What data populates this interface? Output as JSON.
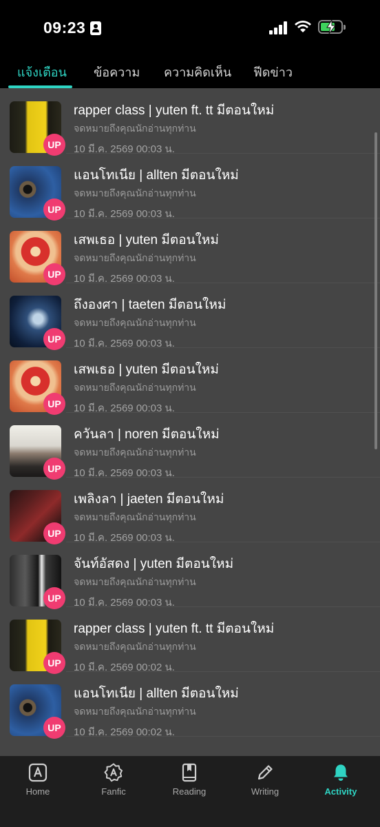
{
  "status_bar": {
    "time": "09:23"
  },
  "tabs": [
    {
      "label": "แจ้งเตือน",
      "active": true
    },
    {
      "label": "ข้อความ",
      "active": false
    },
    {
      "label": "ความคิดเห็น",
      "active": false
    },
    {
      "label": "ฟีดข่าว",
      "active": false
    }
  ],
  "notifications": [
    {
      "title": "rapper class | yuten ft. tt มีตอนใหม่",
      "subtitle": "จดหมายถึงคุณนักอ่านทุกท่าน",
      "date": "10 มี.ค. 2569 00:03 น.",
      "badge": "UP",
      "art": "yellow"
    },
    {
      "title": "แอนโทเนีย | allten มีตอนใหม่",
      "subtitle": "จดหมายถึงคุณนักอ่านทุกท่าน",
      "date": "10 มี.ค. 2569 00:03 น.",
      "badge": "UP",
      "art": "blue"
    },
    {
      "title": "เสพเธอ | yuten มีตอนใหม่",
      "subtitle": "จดหมายถึงคุณนักอ่านทุกท่าน",
      "date": "10 มี.ค. 2569 00:03 น.",
      "badge": "UP",
      "art": "heart"
    },
    {
      "title": "ถึงองศา | taeten มีตอนใหม่",
      "subtitle": "จดหมายถึงคุณนักอ่านทุกท่าน",
      "date": "10 มี.ค. 2569 00:03 น.",
      "badge": "UP",
      "art": "dark"
    },
    {
      "title": "เสพเธอ | yuten มีตอนใหม่",
      "subtitle": "จดหมายถึงคุณนักอ่านทุกท่าน",
      "date": "10 มี.ค. 2569 00:03 น.",
      "badge": "UP",
      "art": "heart"
    },
    {
      "title": "ควันลา | noren มีตอนใหม่",
      "subtitle": "จดหมายถึงคุณนักอ่านทุกท่าน",
      "date": "10 มี.ค. 2569 00:03 น.",
      "badge": "UP",
      "art": "white"
    },
    {
      "title": "เพลิงลา | jaeten มีตอนใหม่",
      "subtitle": "จดหมายถึงคุณนักอ่านทุกท่าน",
      "date": "10 มี.ค. 2569 00:03 น.",
      "badge": "UP",
      "art": "red"
    },
    {
      "title": "จันท์อัสดง | yuten มีตอนใหม่",
      "subtitle": "จดหมายถึงคุณนักอ่านทุกท่าน",
      "date": "10 มี.ค. 2569 00:03 น.",
      "badge": "UP",
      "art": "bw"
    },
    {
      "title": "rapper class | yuten ft. tt มีตอนใหม่",
      "subtitle": "จดหมายถึงคุณนักอ่านทุกท่าน",
      "date": "10 มี.ค. 2569 00:02 น.",
      "badge": "UP",
      "art": "yellow"
    },
    {
      "title": "แอนโทเนีย | allten มีตอนใหม่",
      "subtitle": "จดหมายถึงคุณนักอ่านทุกท่าน",
      "date": "10 มี.ค. 2569 00:02 น.",
      "badge": "UP",
      "art": "blue"
    }
  ],
  "bottom_nav": [
    {
      "label": "Home",
      "icon": "home-icon",
      "active": false
    },
    {
      "label": "Fanfic",
      "icon": "fanfic-icon",
      "active": false
    },
    {
      "label": "Reading",
      "icon": "book-icon",
      "active": false
    },
    {
      "label": "Writing",
      "icon": "pencil-icon",
      "active": false
    },
    {
      "label": "Activity",
      "icon": "bell-icon",
      "active": true
    }
  ],
  "colors": {
    "accent": "#2fd4c3",
    "badge": "#f03c71",
    "list_background": "#454545",
    "nav_background": "#1e1e1e"
  }
}
